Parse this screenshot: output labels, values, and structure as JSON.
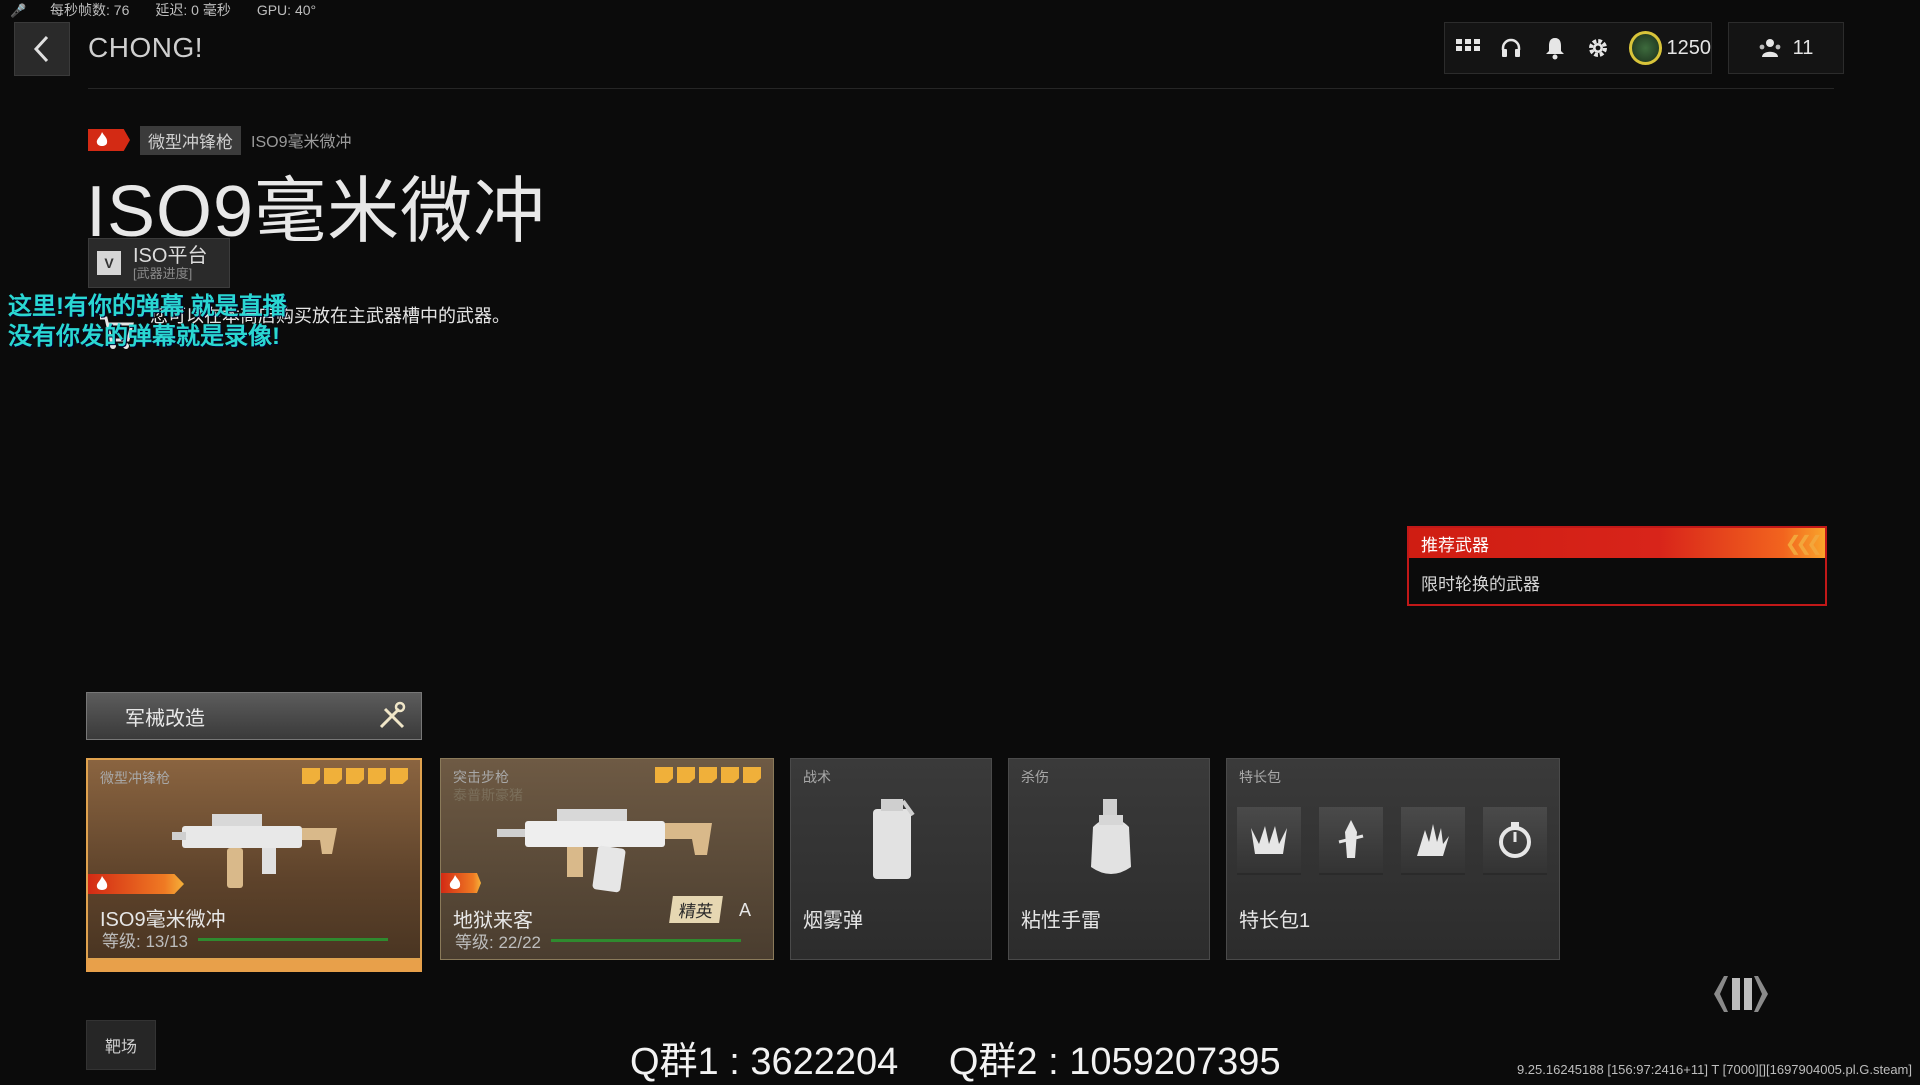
{
  "perf": {
    "fps_label": "每秒帧数:",
    "fps_value": "76",
    "latency_label": "延迟:",
    "latency_value": "0 毫秒",
    "gpu": "GPU: 40°"
  },
  "header": {
    "player_name": "CHONG!",
    "currency": "1250",
    "friends_count": "11"
  },
  "weapon": {
    "category": "微型冲锋枪",
    "breadcrumb_name": "ISO9毫米微冲",
    "title": "ISO9毫米微冲",
    "platform_badge": "V",
    "platform_name": "ISO平台",
    "platform_sub": "[武器进度]",
    "description": "您可以在本商店购买放在主武器槽中的武器。"
  },
  "stream_overlay": {
    "line1": "这里!有你的弹幕 就是直播",
    "line2": "没有你发的弹幕就是录像!"
  },
  "recommended": {
    "title": "推荐武器",
    "body": "限时轮换的武器"
  },
  "gunsmith": {
    "label": "军械改造"
  },
  "loadout": {
    "primary": {
      "label": "微型冲锋枪",
      "name": "ISO9毫米微冲",
      "level": "等级: 13/13",
      "level_fraction": 1.0,
      "attachments": 5
    },
    "secondary": {
      "label": "突击步枪",
      "sub": "泰普斯豪猪",
      "name": "地狱来客",
      "level": "等级: 22/22",
      "level_fraction": 1.0,
      "badge": "精英",
      "badge2": "A",
      "attachments": 5
    },
    "tactical": {
      "label": "战术",
      "name": "烟雾弹"
    },
    "lethal": {
      "label": "杀伤",
      "name": "粘性手雷"
    },
    "perk": {
      "label": "特长包",
      "name": "特长包1"
    }
  },
  "bottom": {
    "range_button": "靶场",
    "qq1": "Q群1 : 3622204",
    "qq2": "Q群2 : 1059207395",
    "version": "9.25.16245188 [156:97:2416+11] T [7000][][1697904005.pl.G.steam]"
  },
  "colors": {
    "accent_red": "#d32a14",
    "accent_gold": "#f0b03a",
    "overlay_cyan": "#2ad7d2"
  }
}
